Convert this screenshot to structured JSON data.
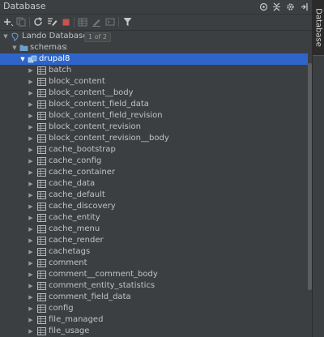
{
  "window": {
    "title": "Database"
  },
  "title_icons": [
    {
      "name": "target-icon",
      "glyph": "⊕"
    },
    {
      "name": "collapse-icon",
      "glyph": "÷"
    },
    {
      "name": "gear-icon",
      "glyph": "⚙"
    },
    {
      "name": "hide-icon",
      "glyph": "⇥"
    }
  ],
  "side_tab": {
    "label": "Database"
  },
  "toolbar": [
    {
      "name": "add-icon",
      "glyph": "+",
      "color": "#c8c8c8"
    },
    {
      "name": "duplicate-icon",
      "glyph": "❐",
      "color": "#777777"
    },
    {
      "name": "refresh-icon",
      "glyph": "⟳",
      "color": "#c8c8c8"
    },
    {
      "name": "sql-properties-icon",
      "glyph": "✎",
      "color": "#c8c8c8"
    },
    {
      "name": "stop-icon",
      "glyph": "■",
      "color": "#c75450"
    },
    {
      "name": "table-icon",
      "glyph": "▦",
      "color": "#777777"
    },
    {
      "name": "edit-icon",
      "glyph": "✎",
      "color": "#777777"
    },
    {
      "name": "console-icon",
      "glyph": "▭",
      "color": "#777777"
    },
    {
      "name": "filter-icon",
      "glyph": "⏷",
      "color": "#c8c8c8"
    }
  ],
  "tree": {
    "datasource": {
      "label": "Lando Database",
      "badge": "1 of 2"
    },
    "schemas": {
      "label": "schemas",
      "count": "1"
    },
    "schema": {
      "label": "drupal8"
    },
    "tables": [
      "batch",
      "block_content",
      "block_content__body",
      "block_content_field_data",
      "block_content_field_revision",
      "block_content_revision",
      "block_content_revision__body",
      "cache_bootstrap",
      "cache_config",
      "cache_container",
      "cache_data",
      "cache_default",
      "cache_discovery",
      "cache_entity",
      "cache_menu",
      "cache_render",
      "cachetags",
      "comment",
      "comment__comment_body",
      "comment_entity_statistics",
      "comment_field_data",
      "config",
      "file_managed",
      "file_usage"
    ]
  },
  "colors": {
    "background": "#3c3f41",
    "selection": "#2f65ca",
    "text": "#c2c2c2",
    "folder": "#6e9ecb"
  }
}
